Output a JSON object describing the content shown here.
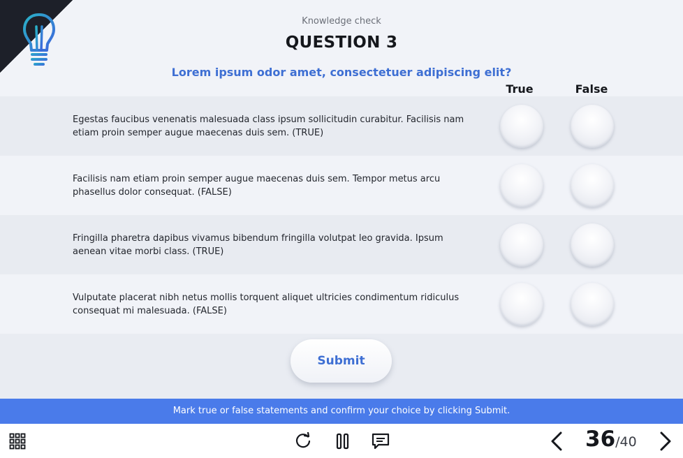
{
  "header": {
    "subtitle": "Knowledge check",
    "title": "QUESTION 3",
    "question": "Lorem ipsum odor amet, consectetuer adipiscing elit?"
  },
  "columns": {
    "true_label": "True",
    "false_label": "False"
  },
  "statements": [
    {
      "text": "Egestas faucibus venenatis malesuada class ipsum sollicitudin curabitur. Facilisis nam etiam proin semper augue maecenas duis sem. (TRUE)"
    },
    {
      "text": "Facilisis nam etiam proin semper augue maecenas duis sem. Tempor metus arcu phasellus dolor consequat. (FALSE)"
    },
    {
      "text": "Fringilla pharetra dapibus vivamus bibendum fringilla volutpat leo gravida. Ipsum aenean vitae morbi class. (TRUE)"
    },
    {
      "text": "Vulputate placerat nibh netus mollis torquent aliquet ultricies condimentum ridiculus consequat mi malesuada. (FALSE)"
    }
  ],
  "submit_label": "Submit",
  "instruction": "Mark true or false statements and confirm your choice by clicking Submit.",
  "footer": {
    "page_current": "36",
    "page_separator": "/",
    "page_total": "40",
    "icons": [
      "grid-menu-icon",
      "replay-icon",
      "pause-icon",
      "chat-icon",
      "chevron-left-icon",
      "chevron-right-icon"
    ]
  },
  "colors": {
    "accent": "#3e6fd3",
    "instruction_bar": "#4a7bea",
    "corner": "#1d2029",
    "bulb_gradient": [
      "#2ab3c8",
      "#3c63dc"
    ]
  }
}
